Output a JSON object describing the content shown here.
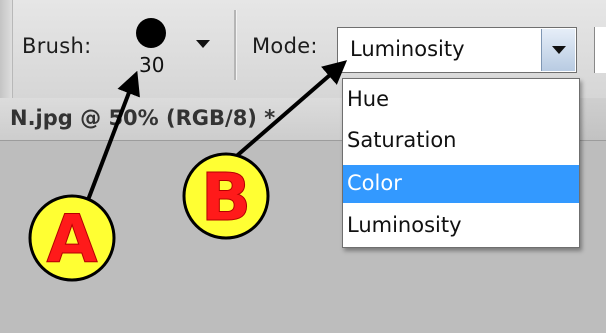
{
  "options_bar": {
    "brush_label": "Brush:",
    "brush_size": "30",
    "mode_label": "Mode:",
    "mode_value": "Luminosity"
  },
  "document_tab": {
    "title": "N.jpg @ 50% (RGB/8) *"
  },
  "mode_dropdown": {
    "items": [
      {
        "label": "Hue"
      },
      {
        "label": "Saturation"
      },
      {
        "label": "Color",
        "selected": true
      },
      {
        "label": "Luminosity"
      }
    ]
  },
  "callouts": {
    "a": {
      "label": "A",
      "fill": "#ffff33",
      "text_color": "#ff1a1a"
    },
    "b": {
      "label": "B",
      "fill": "#ffff33",
      "text_color": "#ff1a1a"
    }
  },
  "colors": {
    "selection": "#3399ff",
    "toolbar": "#dedede",
    "canvas": "#bdbdbd"
  }
}
